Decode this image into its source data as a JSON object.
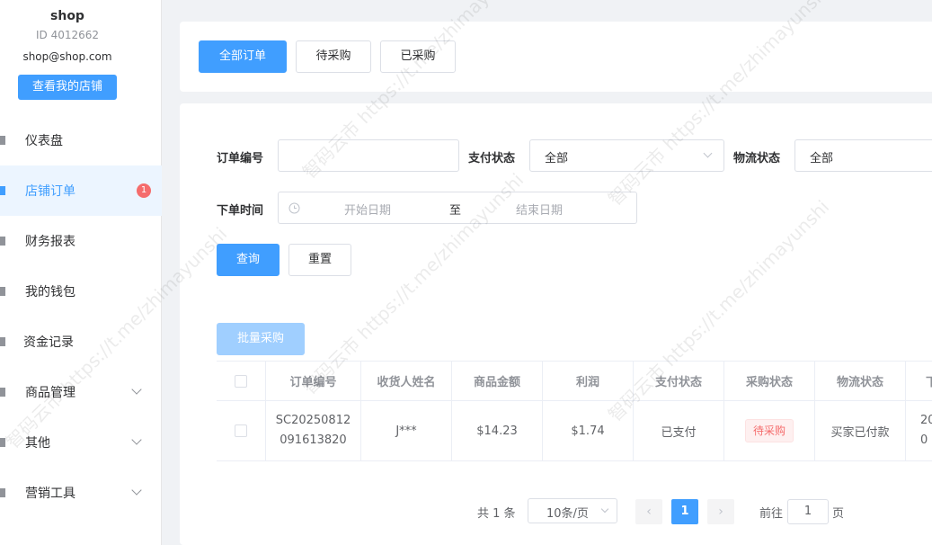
{
  "sidebar": {
    "shop_name": "shop",
    "shop_id": "ID 4012662",
    "shop_email": "shop@shop.com",
    "view_shop_button": "查看我的店铺",
    "items": [
      {
        "label": "仪表盘"
      },
      {
        "label": "店铺订单",
        "badge": "1"
      },
      {
        "label": "财务报表"
      },
      {
        "label": "我的钱包"
      },
      {
        "label": "资金记录"
      },
      {
        "label": "商品管理"
      },
      {
        "label": "其他"
      },
      {
        "label": "营销工具"
      }
    ]
  },
  "tabs": [
    "全部订单",
    "待采购",
    "已采购"
  ],
  "filters": {
    "order_no_label": "订单编号",
    "order_no_value": "",
    "pay_status_label": "支付状态",
    "pay_status_value": "全部",
    "logistics_status_label": "物流状态",
    "logistics_status_value": "全部",
    "order_time_label": "下单时间",
    "start_date_placeholder": "开始日期",
    "date_separator": "至",
    "end_date_placeholder": "结束日期",
    "search_button": "查询",
    "reset_button": "重置"
  },
  "batch_purchase_button": "批量采购",
  "table": {
    "headers": [
      "订单编号",
      "收货人姓名",
      "商品金额",
      "利润",
      "支付状态",
      "采购状态",
      "物流状态",
      "下"
    ],
    "rows": [
      {
        "order_no_line1": "SC20250812",
        "order_no_line2": "091613820",
        "receiver": "J***",
        "amount": "$14.23",
        "profit": "$1.74",
        "pay_status": "已支付",
        "purchase_status": "待采购",
        "logistics_status": "买家已付款",
        "order_time_line1": "20",
        "order_time_line2": "0"
      }
    ]
  },
  "pagination": {
    "total": "共 1 条",
    "page_size": "10条/页",
    "prev": "‹",
    "current_page": "1",
    "next": "›",
    "goto_label": "前往",
    "goto_value": "1",
    "goto_suffix": "页"
  },
  "watermark": "智码云市 https://t.me/zhimayunshi",
  "colors": {
    "primary": "#409eff",
    "danger": "#f56c6c"
  }
}
